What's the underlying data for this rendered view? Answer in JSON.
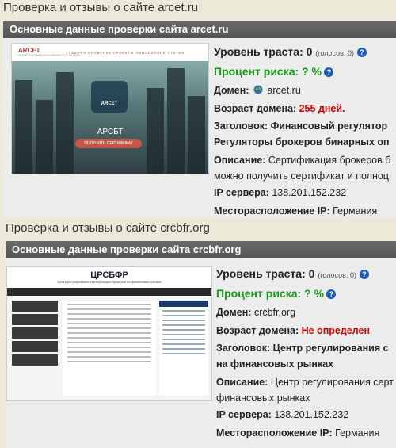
{
  "sites": [
    {
      "title": "Проверка и отзывы о сайте arcet.ru",
      "header": "Основные данные проверки сайта arcet.ru",
      "trust_label": "Уровень траста:",
      "trust_value": "0",
      "votes": "(голосов: 0)",
      "risk": "Процент риска: ? %",
      "domain_label": "Домен:",
      "domain": "arcet.ru",
      "age_label": "Возраст домена:",
      "age_value": "255 дней.",
      "heading_label": "Заголовок:",
      "heading_line1": "Финансовый регулятор",
      "heading_line2": "Регуляторы брокеров бинарных оп",
      "desc_label": "Описание:",
      "desc_line1": "Сертификация брокеров б",
      "desc_line2": "можно получить сертификат и полноц",
      "ip_label": "IP сервера:",
      "ip": "138.201.152.232",
      "loc_label": "Месторасположение IP:",
      "loc": "Германия",
      "thumb": {
        "logo": "ARCET",
        "subtitle": "Association of regulators and certification of foreign trading",
        "nav": "ГЛАВНАЯ  ПРОВЕРКА  ПРОЕКТЫ  ОБНОВЛЕНИЕ  СТАТЬИ",
        "emblem": "ARCET",
        "name": "АРСБТ",
        "button": "ПОЛУЧИТЬ СЕРТИФИКАТ"
      }
    },
    {
      "title": "Проверка и отзывы о сайте crcbfr.org",
      "header": "Основные данные проверки сайта crcbfr.org",
      "trust_label": "Уровень траста:",
      "trust_value": "0",
      "votes": "(голосов: 0)",
      "risk": "Процент риска: ? %",
      "domain_label": "Домен:",
      "domain": "crcbfr.org",
      "age_label": "Возраст домена:",
      "age_value": "Не определен",
      "heading_label": "Заголовок:",
      "heading_line1": "Центр регулирования с",
      "heading_line2": "на финансовых рынках",
      "desc_label": "Описание:",
      "desc_line1": "Центр регулирования серт",
      "desc_line2": "финансовых рынках",
      "ip_label": "IP сервера:",
      "ip": "138.201.152.232",
      "loc_label": "Месторасположение IP:",
      "loc": "Германия",
      "thumb": {
        "logo": "ЦРСБФР",
        "tagline": "Центр регулирования сертификации брокеров на финансовых рынках"
      }
    }
  ],
  "colors": {
    "page_bg": "#ece9d8",
    "bar_bg": "#5e5e5e",
    "risk_green": "#1a9a1a",
    "age_red": "#d40000",
    "help_blue": "#1d5db8"
  }
}
